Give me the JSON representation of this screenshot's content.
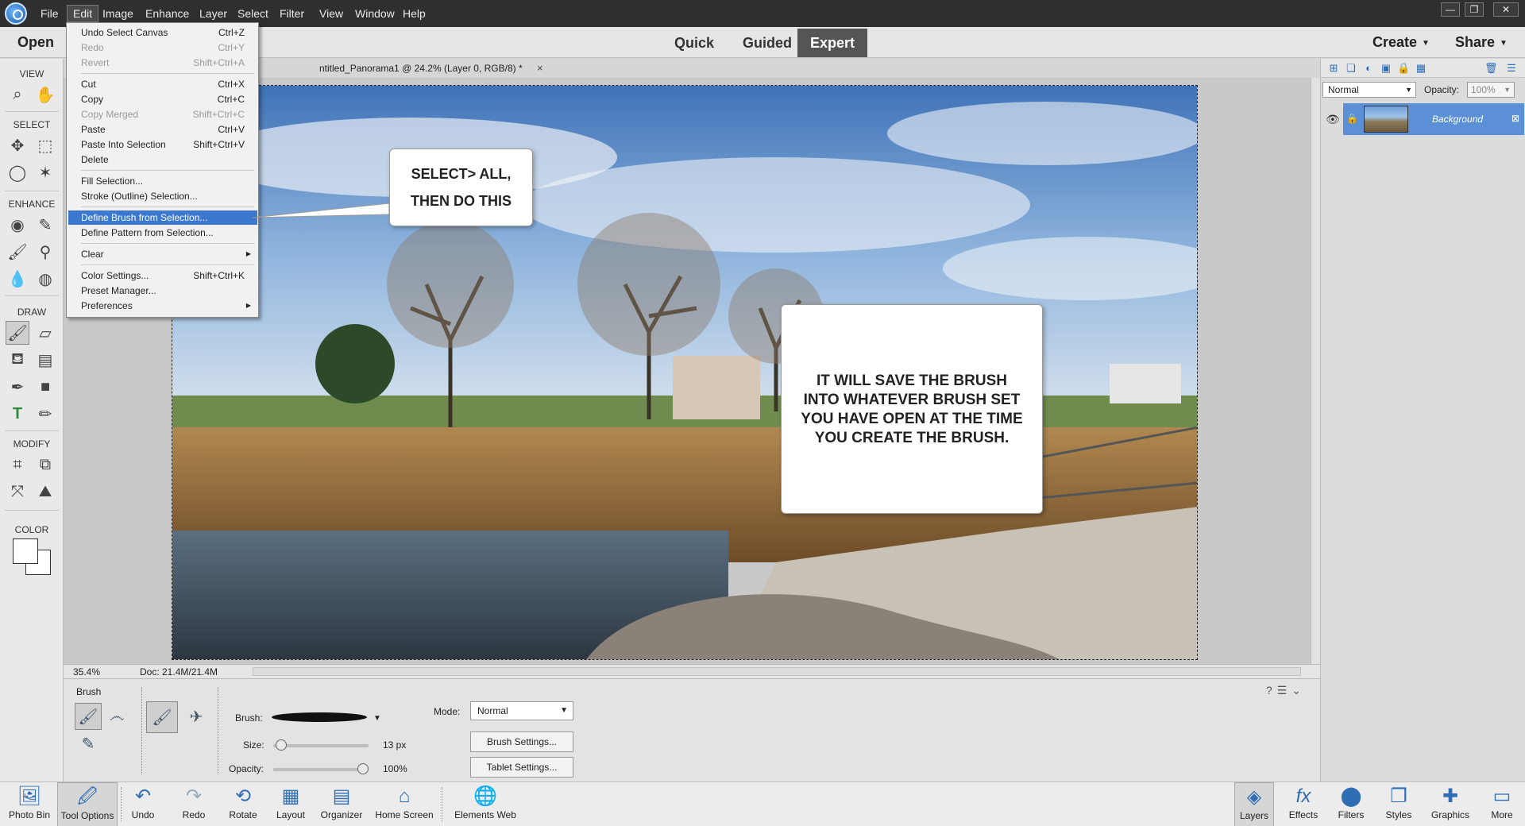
{
  "menubar": {
    "items": [
      "File",
      "Edit",
      "Image",
      "Enhance",
      "Layer",
      "Select",
      "Filter",
      "View",
      "Window",
      "Help"
    ],
    "active_index": 1,
    "window_buttons": [
      "—",
      "❐",
      "✕"
    ]
  },
  "modebar": {
    "open_label": "Open",
    "modes": [
      "Quick",
      "Guided",
      "Expert"
    ],
    "selected_mode": "Expert",
    "create_label": "Create",
    "share_label": "Share"
  },
  "toolbox": {
    "sections": [
      "VIEW",
      "SELECT",
      "ENHANCE",
      "DRAW",
      "MODIFY",
      "COLOR"
    ]
  },
  "document": {
    "tab_label": "ntitled_Panorama1 @ 24.2% (Layer 0, RGB/8) *",
    "close_glyph": "×"
  },
  "statusbar": {
    "zoom": "35.4%",
    "doc_size": "Doc: 21.4M/21.4M"
  },
  "edit_menu": {
    "items": [
      {
        "label": "Undo Select Canvas",
        "shortcut": "Ctrl+Z",
        "disabled": false
      },
      {
        "label": "Redo",
        "shortcut": "Ctrl+Y",
        "disabled": true
      },
      {
        "label": "Revert",
        "shortcut": "Shift+Ctrl+A",
        "disabled": true
      },
      {
        "label": "Cut",
        "shortcut": "Ctrl+X",
        "disabled": false
      },
      {
        "label": "Copy",
        "shortcut": "Ctrl+C",
        "disabled": false
      },
      {
        "label": "Copy Merged",
        "shortcut": "Shift+Ctrl+C",
        "disabled": true
      },
      {
        "label": "Paste",
        "shortcut": "Ctrl+V",
        "disabled": false
      },
      {
        "label": "Paste Into Selection",
        "shortcut": "Shift+Ctrl+V",
        "disabled": false
      },
      {
        "label": "Delete",
        "shortcut": "",
        "disabled": false
      },
      {
        "label": "Fill Selection...",
        "shortcut": "",
        "disabled": false
      },
      {
        "label": "Stroke (Outline) Selection...",
        "shortcut": "",
        "disabled": false
      },
      {
        "label": "Define Brush from Selection...",
        "shortcut": "",
        "disabled": false,
        "highlighted": true
      },
      {
        "label": "Define Pattern from Selection...",
        "shortcut": "",
        "disabled": false
      },
      {
        "label": "Clear",
        "shortcut": "",
        "disabled": false,
        "submenu": true
      },
      {
        "label": "Color Settings...",
        "shortcut": "Shift+Ctrl+K",
        "disabled": false
      },
      {
        "label": "Preset Manager...",
        "shortcut": "",
        "disabled": false
      },
      {
        "label": "Preferences",
        "shortcut": "",
        "disabled": false,
        "submenu": true
      }
    ]
  },
  "callouts": {
    "first_line1": "SELECT> ALL,",
    "first_line2": "THEN DO THIS",
    "second_line1": "IT WILL SAVE THE BRUSH",
    "second_line2": "INTO WHATEVER BRUSH SET",
    "second_line3": "YOU HAVE OPEN AT THE TIME",
    "second_line4": "YOU CREATE THE BRUSH."
  },
  "tool_options": {
    "title": "Brush",
    "brush_label": "Brush:",
    "size_label": "Size:",
    "size_value": "13 px",
    "size_fraction": 0.03,
    "opacity_label": "Opacity:",
    "opacity_value": "100%",
    "opacity_fraction": 1.0,
    "mode_label": "Mode:",
    "mode_value": "Normal",
    "brush_settings_label": "Brush Settings...",
    "tablet_settings_label": "Tablet Settings..."
  },
  "layers_panel": {
    "blend_mode": "Normal",
    "opacity_label": "Opacity:",
    "opacity_value": "100%",
    "layer_name": "Background"
  },
  "taskbar": {
    "left": [
      "Photo Bin",
      "Tool Options",
      "Undo",
      "Redo",
      "Rotate",
      "Layout",
      "Organizer",
      "Home Screen",
      "Elements Web"
    ],
    "right": [
      "Layers",
      "Effects",
      "Filters",
      "Styles",
      "Graphics",
      "More"
    ]
  },
  "colors": {
    "accent_highlight": "#3d78cf",
    "menubar_bg": "#2f2f2f",
    "layer_selected": "#5b8fd6"
  }
}
